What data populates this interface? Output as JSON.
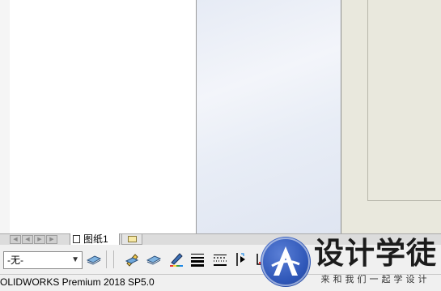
{
  "tabs": {
    "sheet_label": "图纸1",
    "nav_buttons": [
      "first-icon",
      "prev-icon",
      "next-icon",
      "last-icon"
    ]
  },
  "toolbar": {
    "layer_value": "-无-",
    "tools": [
      "layer-properties-icon",
      "line-color-icon",
      "line-thickness-icon",
      "line-style-icon",
      "hide-show-edges-icon",
      "color-display-mode-icon",
      "grid-icon",
      "pointer-icon"
    ]
  },
  "status": {
    "text": "OLIDWORKS Premium 2018 SP5.0"
  },
  "watermark": {
    "title": "设计学徒",
    "subtitle": "来和我们一起学设计",
    "accent": "#2f57b8"
  }
}
